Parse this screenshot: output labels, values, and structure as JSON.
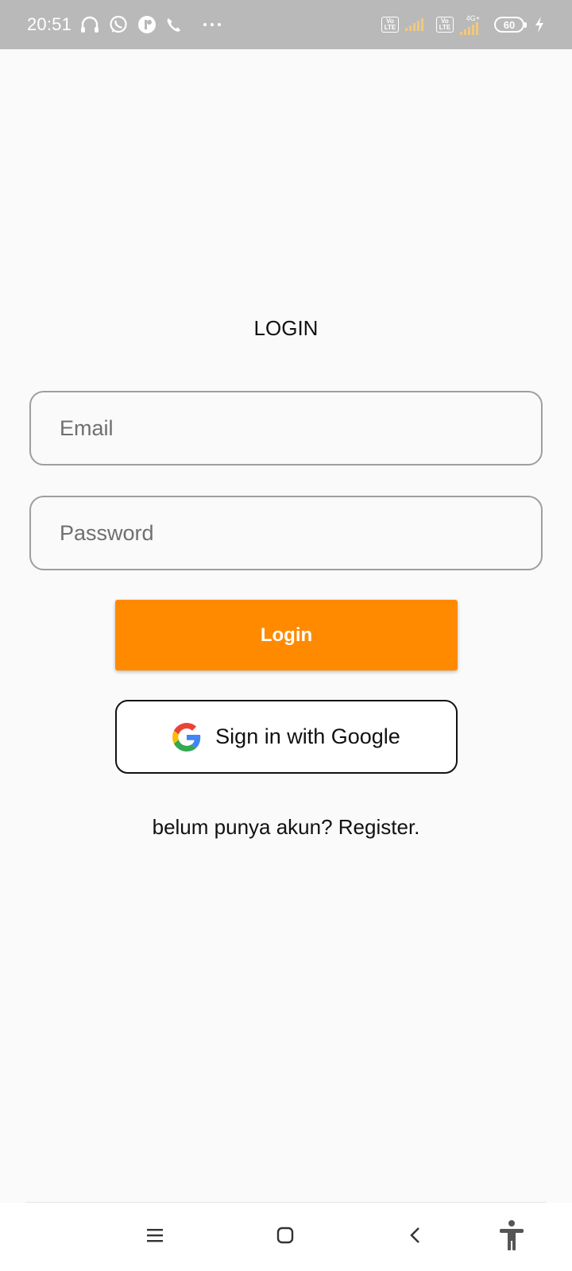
{
  "status_bar": {
    "time": "20:51",
    "left_icons": [
      "headset-icon",
      "whatsapp-icon",
      "app-notification-icon",
      "phone-call-icon",
      "more-dots-icon"
    ],
    "sim1_label_top": "Vo",
    "sim1_label_bottom": "LTE",
    "sim2_label_top": "Vo",
    "sim2_label_bottom": "LTE",
    "network_type": "4G+",
    "battery_level": "60",
    "charging": true,
    "colors": {
      "bar": "#b9b9b9",
      "signal": "#f2c97a"
    }
  },
  "login": {
    "title": "LOGIN",
    "email_placeholder": "Email",
    "password_placeholder": "Password",
    "login_button": "Login",
    "google_button": "Sign in with Google",
    "register_prompt": "belum punya akun?",
    "register_link": "Register."
  },
  "colors": {
    "accent": "#ff8a00",
    "background": "#fafafa"
  },
  "nav_bar": {
    "buttons": [
      "menu-icon",
      "home-icon",
      "back-icon",
      "accessibility-icon"
    ]
  }
}
